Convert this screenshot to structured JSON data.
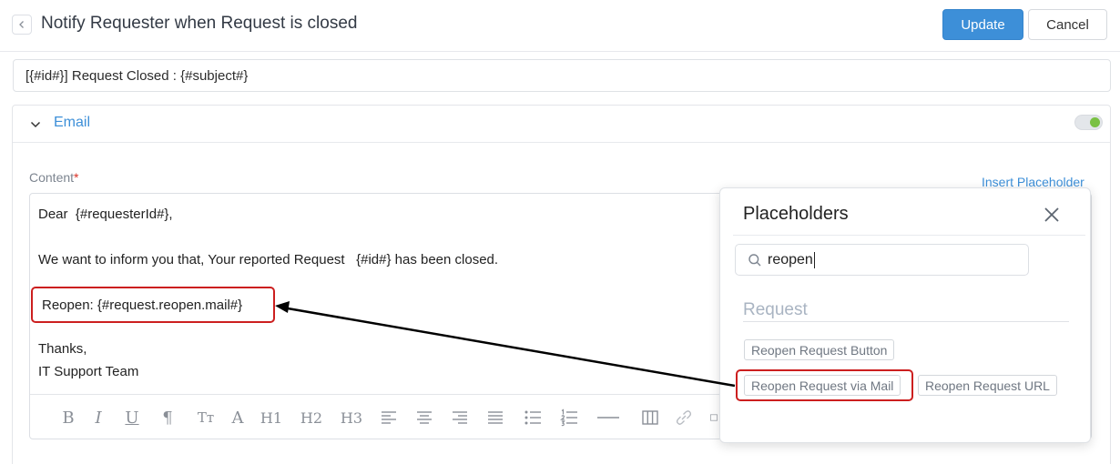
{
  "header": {
    "title": "Notify Requester when Request is closed",
    "update_label": "Update",
    "cancel_label": "Cancel"
  },
  "subject": {
    "value": "[{#id#}] Request Closed : {#subject#}"
  },
  "email_section": {
    "label": "Email",
    "enabled": true,
    "content_label": "Content",
    "required_marker": "*",
    "insert_placeholder_label": "Insert Placeholder"
  },
  "editor": {
    "lines": [
      "Dear  {#requesterId#},",
      "We want to inform you that, Your reported Request   {#id#} has been closed.",
      "Reopen: {#request.reopen.mail#}",
      "Thanks,",
      "IT Support Team"
    ],
    "toolbar": {
      "bold": "B",
      "italic": "I",
      "underline": "U",
      "paragraph": "¶",
      "font_size": "Tт",
      "font": "A",
      "h1": "H1",
      "h2": "H2",
      "h3": "H3"
    }
  },
  "placeholders_popup": {
    "title": "Placeholders",
    "search_value": "reopen",
    "group_label": "Request",
    "items": [
      "Reopen Request Button",
      "Reopen Request via Mail",
      "Reopen Request URL"
    ]
  },
  "colors": {
    "accent": "#3d8fd8",
    "highlight": "#cc1f1f",
    "toggle_on": "#7ac143"
  }
}
